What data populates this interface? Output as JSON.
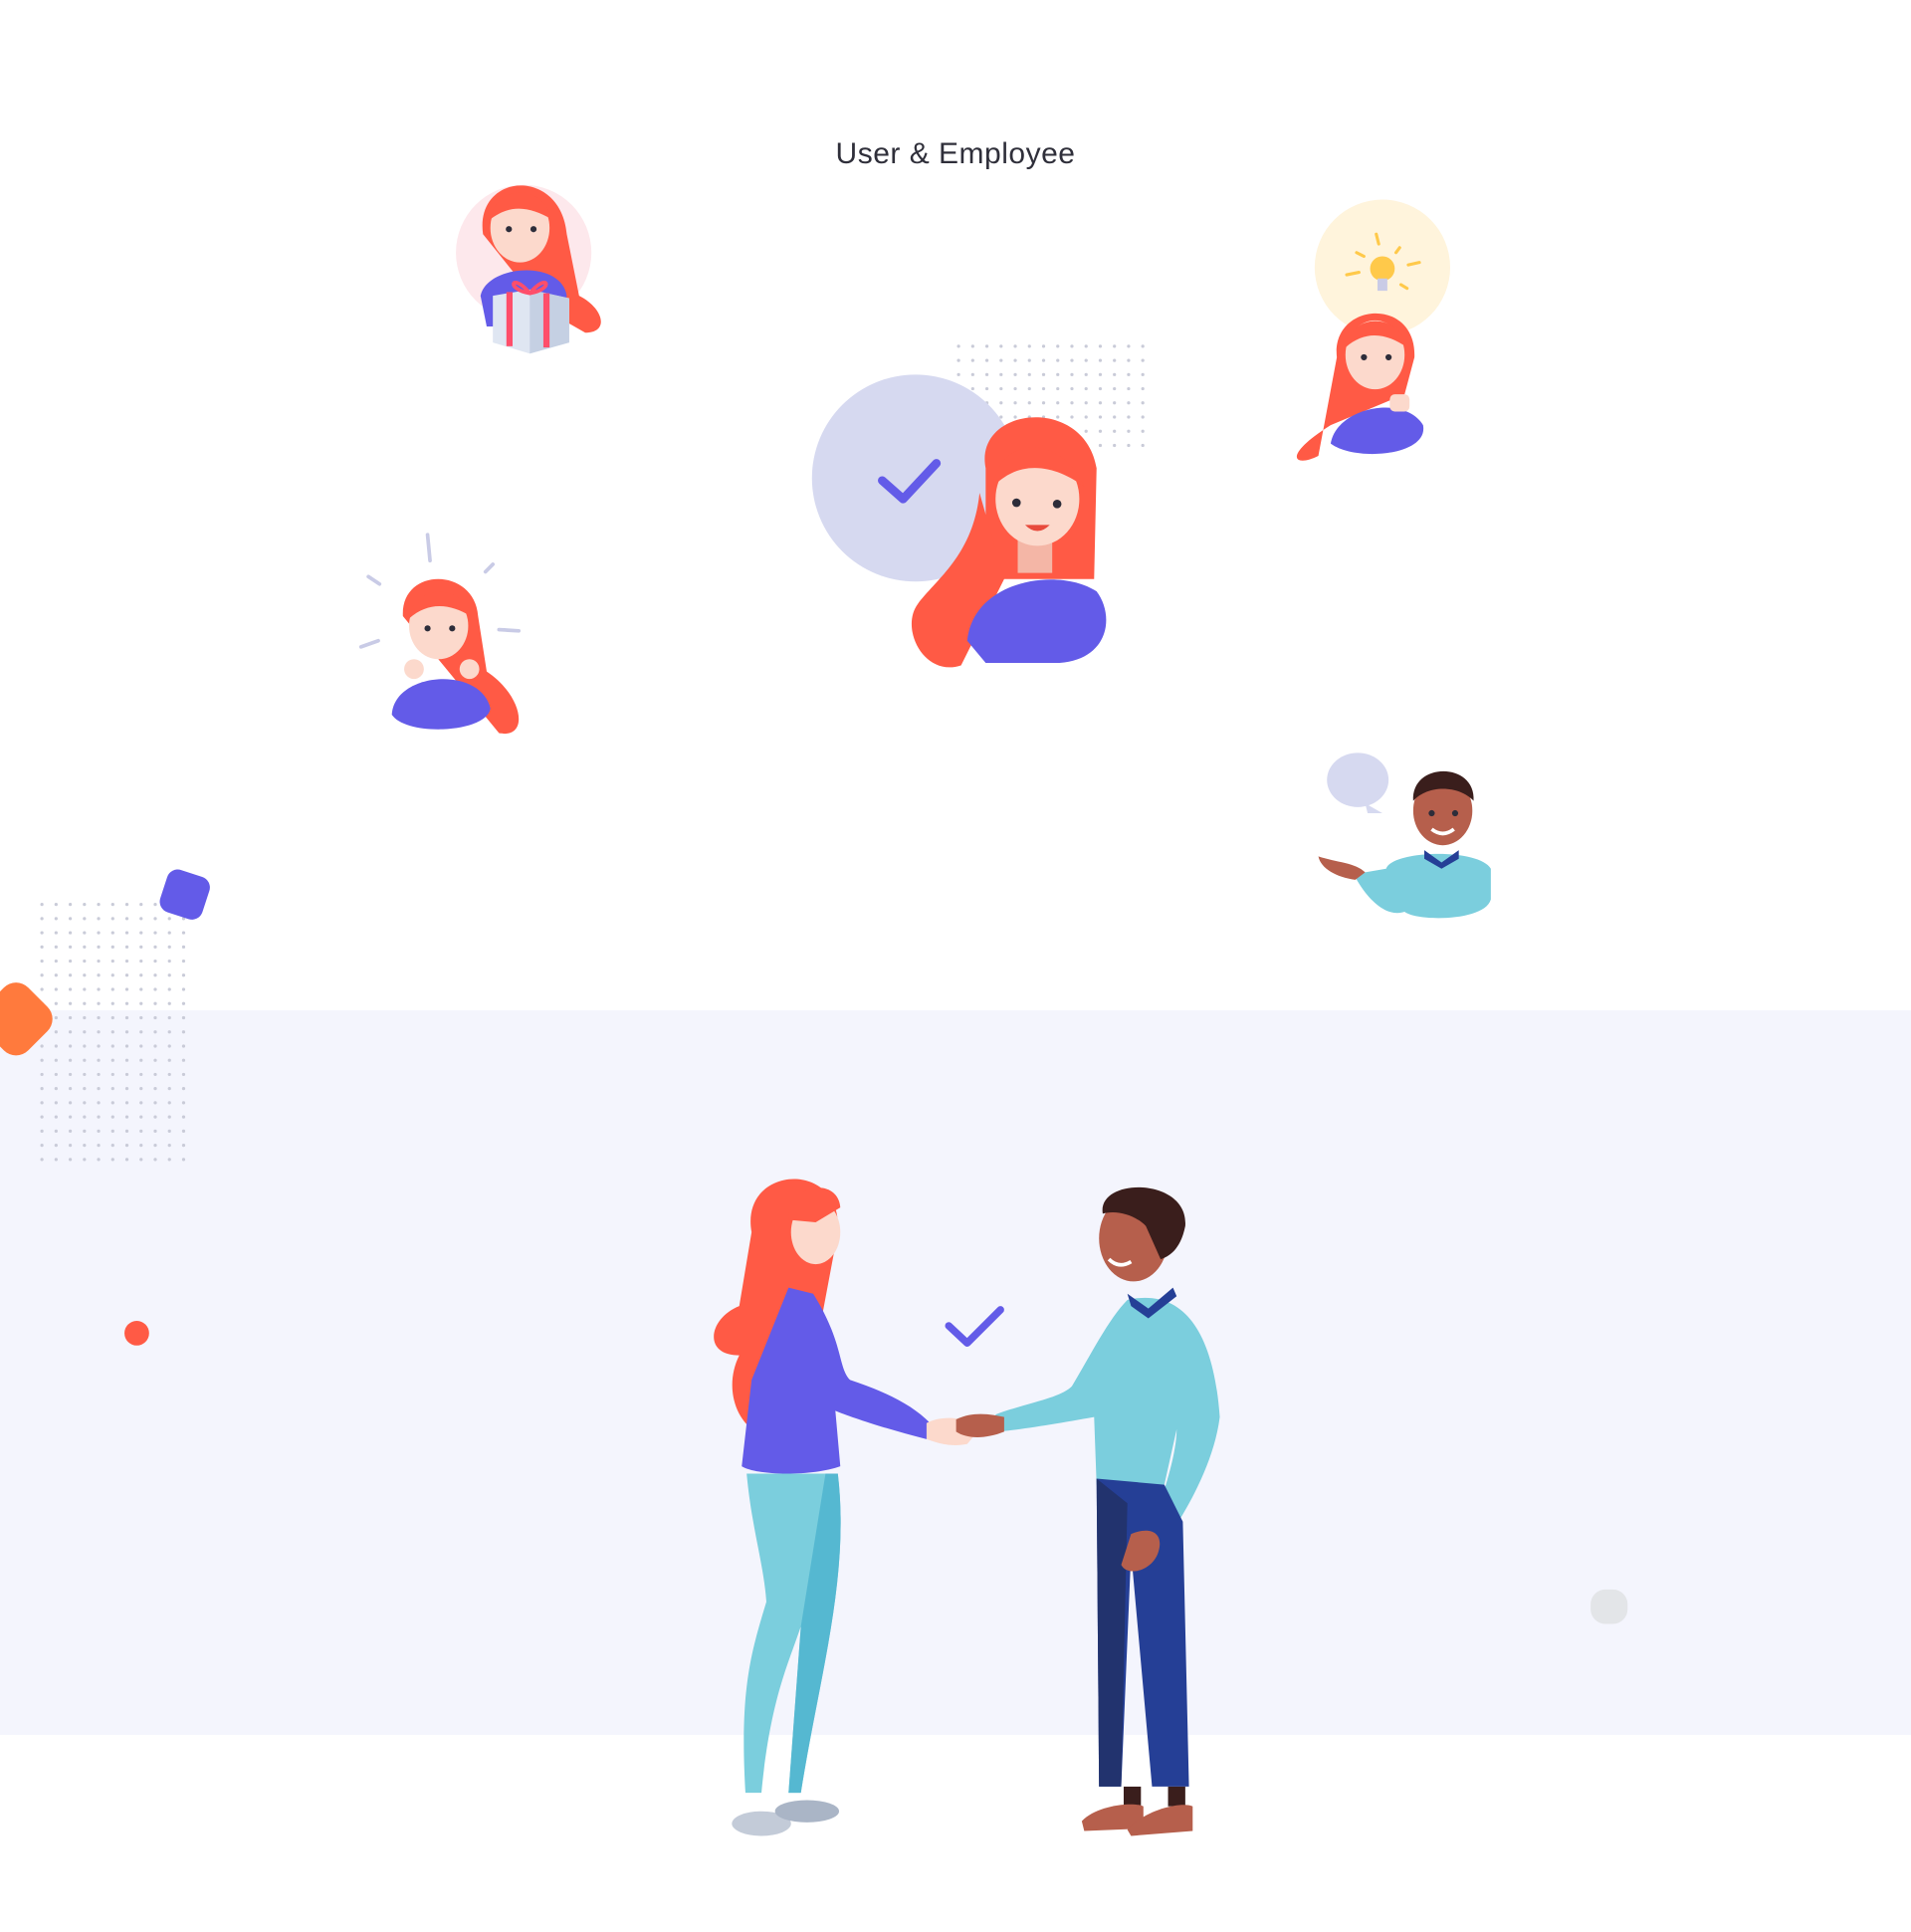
{
  "title": "User & Employee",
  "colors": {
    "band": "#f4f5fd",
    "hair": "#ff5a45",
    "sweater_purple": "#635be8",
    "lavender": "#d6d9f0",
    "teal": "#7bcedd",
    "navy": "#253f96",
    "skin_light": "#fcd9cc",
    "skin_dark": "#b65f4c",
    "orange": "#ff7a3d",
    "bulb_glow": "#fff4dc",
    "bulb": "#ffc94a"
  },
  "icons": [
    "checkmark-icon",
    "lightbulb-icon",
    "speech-bubble-icon",
    "gift-icon"
  ]
}
